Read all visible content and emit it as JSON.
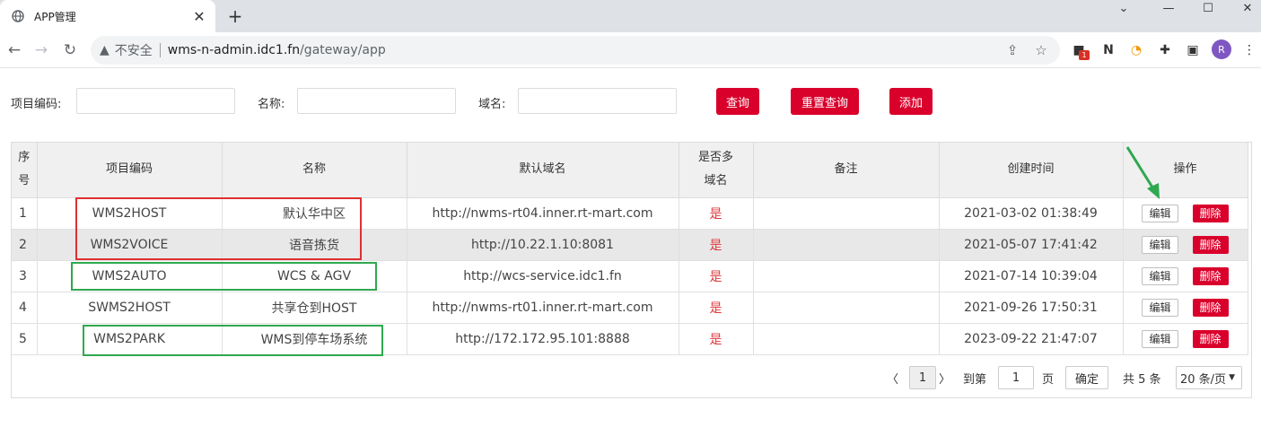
{
  "browser": {
    "tab_title": "APP管理",
    "insecure_label": "不安全",
    "url_host": "wms-n-admin.idc1.fn",
    "url_path": "/gateway/app",
    "avatar_letter": "R",
    "ext_badge": "1"
  },
  "search": {
    "code_label": "项目编码:",
    "name_label": "名称:",
    "domain_label": "域名:",
    "query_button": "查询",
    "reset_button": "重置查询",
    "add_button": "添加"
  },
  "table": {
    "headers": {
      "idx_line1": "序",
      "idx_line2": "号",
      "code": "项目编码",
      "name": "名称",
      "domain": "默认域名",
      "multi_line1": "是否多",
      "multi_line2": "域名",
      "remark": "备注",
      "created": "创建时间",
      "ops": "操作"
    },
    "edit_label": "编辑",
    "delete_label": "删除",
    "rows": [
      {
        "idx": "1",
        "code": "WMS2HOST",
        "name": "默认华中区",
        "domain": "http://nwms-rt04.inner.rt-mart.com",
        "multi": "是",
        "remark": "",
        "created": "2021-03-02 01:38:49"
      },
      {
        "idx": "2",
        "code": "WMS2VOICE",
        "name": "语音拣货",
        "domain": "http://10.22.1.10:8081",
        "multi": "是",
        "remark": "",
        "created": "2021-05-07 17:41:42"
      },
      {
        "idx": "3",
        "code": "WMS2AUTO",
        "name": "WCS & AGV",
        "domain": "http://wcs-service.idc1.fn",
        "multi": "是",
        "remark": "",
        "created": "2021-07-14 10:39:04"
      },
      {
        "idx": "4",
        "code": "SWMS2HOST",
        "name": "共享仓到HOST",
        "domain": "http://nwms-rt01.inner.rt-mart.com",
        "multi": "是",
        "remark": "",
        "created": "2021-09-26 17:50:31"
      },
      {
        "idx": "5",
        "code": "WMS2PARK",
        "name": "WMS到停车场系统",
        "domain": "http://172.172.95.101:8888",
        "multi": "是",
        "remark": "",
        "created": "2023-09-22 21:47:07"
      }
    ]
  },
  "pagination": {
    "current_page": "1",
    "goto_label": "到第",
    "goto_value": "1",
    "page_unit": "页",
    "confirm": "确定",
    "total": "共 5 条",
    "page_size": "20 条/页"
  },
  "colors": {
    "primary": "#d9002b",
    "annotation_red": "#e03030",
    "annotation_green": "#2fa84f"
  }
}
